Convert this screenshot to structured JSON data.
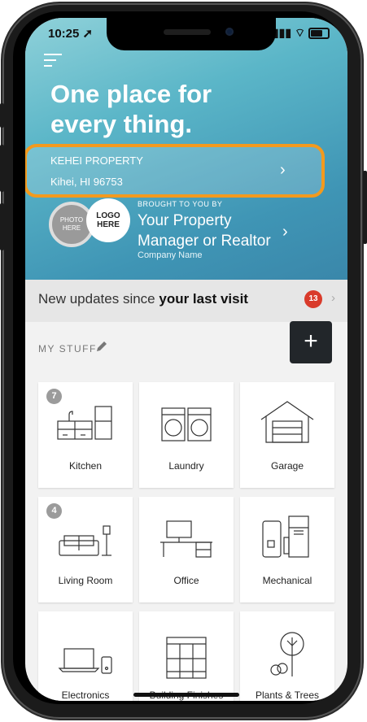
{
  "status_bar": {
    "time": "10:25",
    "signal": "▮▮▮",
    "wifi": "⌔"
  },
  "hero": {
    "title_line1": "One place for",
    "title_line2": "every thing."
  },
  "property": {
    "name": "KEHEI PROPERTY",
    "address": "Kihei, HI 96753",
    "chevron": "›"
  },
  "agent": {
    "photo_line1": "PHOTO",
    "photo_line2": "HERE",
    "logo_line1": "LOGO",
    "logo_line2": "HERE",
    "brought_by": "BROUGHT TO YOU BY",
    "manager_line1": "Your Property",
    "manager_line2": "Manager or Realtor",
    "company": "Company Name",
    "chevron": "›"
  },
  "updates": {
    "text_prefix": "New updates since ",
    "text_bold": "your last visit",
    "badge_count": "13",
    "chevron": "›"
  },
  "my_stuff": {
    "label": "MY STUFF",
    "add_label": "+"
  },
  "tiles": [
    {
      "label": "Kitchen",
      "count": "7"
    },
    {
      "label": "Laundry",
      "count": ""
    },
    {
      "label": "Garage",
      "count": ""
    },
    {
      "label": "Living Room",
      "count": "4"
    },
    {
      "label": "Office",
      "count": ""
    },
    {
      "label": "Mechanical",
      "count": ""
    },
    {
      "label": "Electronics",
      "count": ""
    },
    {
      "label": "Building Finishes",
      "count": ""
    },
    {
      "label": "Plants & Trees",
      "count": ""
    }
  ],
  "colors": {
    "accent_orange": "#f39a1e",
    "badge_red": "#d93b2b",
    "hero_teal": "#5bb6c8",
    "add_button_dark": "#22262a"
  }
}
